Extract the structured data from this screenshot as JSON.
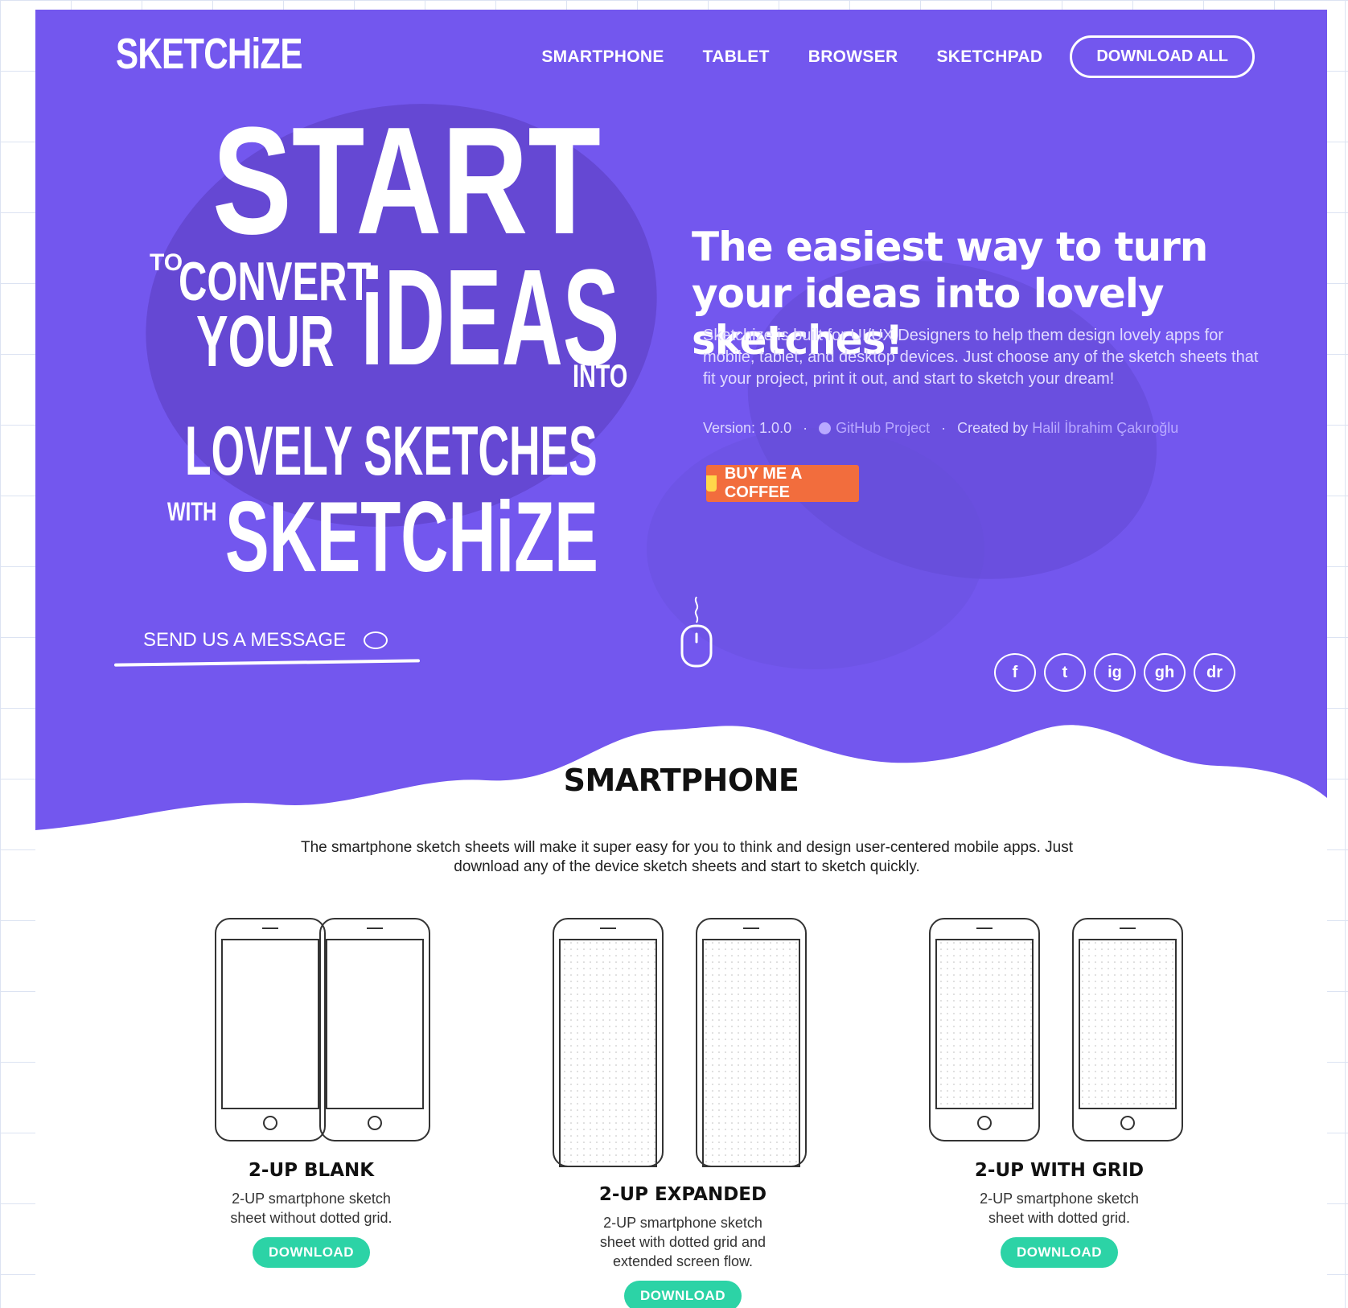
{
  "nav": {
    "logo": "SKETCHiZE",
    "links": [
      "SMARTPHONE",
      "TABLET",
      "BROWSER",
      "SKETCHPAD"
    ],
    "download_all": "DOWNLOAD ALL"
  },
  "headline": {
    "start": "START",
    "to": "TO",
    "convert": "CONVERT",
    "your": "YOUR",
    "ideas": "iDEAS",
    "into": "INTO",
    "lovely": "LOVELY SKETCHES",
    "with": "WITH",
    "sketchize": "SKETCHiZE"
  },
  "hero": {
    "title": "The easiest way to turn your ideas into lovely sketches!",
    "description": "Sketchize is built for UI/UX Designers to help them design lovely apps for mobile, tablet, and desktop devices. Just choose any of the sketch sheets that fit your project, print it out, and start to sketch your dream!",
    "version": "Version: 1.0.0",
    "github": "GitHub Project",
    "created_by": "Created by",
    "author": "Halil İbrahim Çakıroğlu",
    "coffee": "BUY ME A COFFEE",
    "send_message": "SEND US A MESSAGE"
  },
  "social": [
    "f",
    "t",
    "ig",
    "gh",
    "dr"
  ],
  "section": {
    "title": "SMARTPHONE",
    "description": "The smartphone sketch sheets will make it super easy for you to think and design user-centered mobile apps. Just download any of the device sketch sheets and start to sketch quickly."
  },
  "cards": [
    {
      "title": "2-UP BLANK",
      "description": "2-UP smartphone sketch sheet without dotted grid.",
      "button": "DOWNLOAD"
    },
    {
      "title": "2-UP EXPANDED",
      "description": "2-UP smartphone sketch sheet with dotted grid and extended screen flow.",
      "button": "DOWNLOAD"
    },
    {
      "title": "2-UP WITH GRID",
      "description": "2-UP smartphone sketch sheet with dotted grid.",
      "button": "DOWNLOAD"
    }
  ],
  "colors": {
    "hero_bg": "#7357ee",
    "coffee": "#f26d3d",
    "download_btn": "#2cd3a6"
  }
}
